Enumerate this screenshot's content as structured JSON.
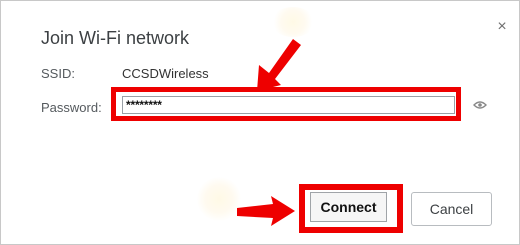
{
  "dialog": {
    "title": "Join Wi-Fi network",
    "close_icon": "close-icon"
  },
  "form": {
    "ssid_label": "SSID:",
    "ssid_value": "CCSDWireless",
    "password_label": "Password:",
    "password_value": "********",
    "show_password_icon": "eye-icon"
  },
  "buttons": {
    "connect_label": "Connect",
    "cancel_label": "Cancel"
  },
  "annotations": {
    "highlight_color": "#ee0000",
    "arrow_color": "#ee0000"
  }
}
